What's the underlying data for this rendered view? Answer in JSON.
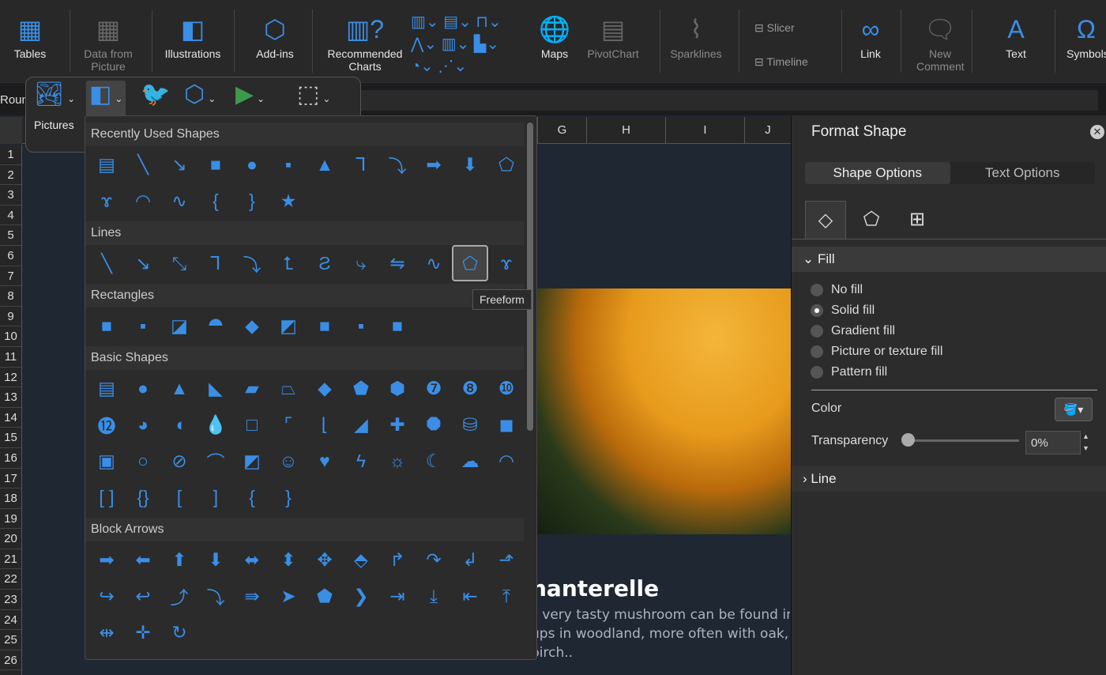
{
  "ribbon": {
    "items": [
      {
        "label": "Tables",
        "icon": "table-icon",
        "glyph": "▦",
        "enabled": true
      },
      {
        "label": "Data from Picture",
        "icon": "data-from-picture-icon",
        "glyph": "▦",
        "enabled": false
      },
      {
        "label": "Illustrations",
        "icon": "shapes-icon",
        "glyph": "◧",
        "enabled": true
      },
      {
        "label": "Add-ins",
        "icon": "hexagon-addins-icon",
        "glyph": "⬡",
        "enabled": true
      },
      {
        "label": "Recommended Charts",
        "icon": "recommended-charts-icon",
        "glyph": "▥?",
        "enabled": true
      },
      {
        "label": "Maps",
        "icon": "globe-icon",
        "glyph": "🌐",
        "enabled": true
      },
      {
        "label": "PivotChart",
        "icon": "pivotchart-icon",
        "glyph": "▤",
        "enabled": false
      },
      {
        "label": "Sparklines",
        "icon": "sparklines-icon",
        "glyph": "⌇",
        "enabled": false
      },
      {
        "label": "Link",
        "icon": "link-icon",
        "glyph": "∞",
        "enabled": true
      },
      {
        "label": "New Comment",
        "icon": "new-comment-icon",
        "glyph": "🗨",
        "enabled": false
      },
      {
        "label": "Text",
        "icon": "text-icon",
        "glyph": "A",
        "enabled": true
      },
      {
        "label": "Symbols",
        "icon": "omega-icon",
        "glyph": "Ω",
        "enabled": true
      }
    ],
    "slicer": "Slicer",
    "timeline": "Timeline"
  },
  "name_box": "Roun",
  "illustrations_popover": {
    "pictures_label": "Pictures",
    "items": [
      "pictures-icon",
      "shapes-icon",
      "icons-icon",
      "3d-models-icon",
      "smartart-icon",
      "screenshot-icon"
    ]
  },
  "columns": [
    "G",
    "H",
    "I",
    "J"
  ],
  "rows": [
    "1",
    "2",
    "3",
    "4",
    "5",
    "6",
    "7",
    "8",
    "9",
    "10",
    "11",
    "12",
    "13",
    "14",
    "15",
    "16",
    "17",
    "18",
    "19",
    "20",
    "21",
    "22",
    "23",
    "24",
    "25",
    "26"
  ],
  "slide": {
    "title": "hanterelle",
    "body": [
      "s very tasty mushroom can be found in sma",
      "ups in woodland, more often with oak, bee",
      "birch.."
    ]
  },
  "shapes_gallery": {
    "sections": [
      {
        "title": "Recently Used Shapes",
        "shapes": [
          "text-box",
          "line",
          "arrow-line",
          "rectangle",
          "oval",
          "rounded-rectangle",
          "triangle",
          "elbow-connector",
          "elbow-arrow-connector",
          "right-arrow",
          "down-arrow",
          "freeform",
          "scribble",
          "arc",
          "curve",
          "left-brace",
          "right-brace",
          "star"
        ]
      },
      {
        "title": "Lines",
        "shapes": [
          "line",
          "arrow-line",
          "double-arrow-line",
          "elbow-connector",
          "elbow-arrow-connector",
          "elbow-double-arrow",
          "curved-connector",
          "curved-arrow-connector",
          "curved-double-arrow",
          "curve",
          "freeform",
          "scribble"
        ]
      },
      {
        "title": "Rectangles",
        "shapes": [
          "rectangle",
          "rounded-rectangle",
          "snip-single-corner",
          "snip-same-side",
          "snip-diagonal",
          "snip-round",
          "round-single-corner",
          "round-same-side",
          "round-diagonal"
        ]
      },
      {
        "title": "Basic Shapes",
        "shapes": [
          "text-box",
          "oval",
          "triangle",
          "right-triangle",
          "parallelogram",
          "trapezoid",
          "diamond",
          "pentagon",
          "hexagon",
          "heptagon",
          "octagon",
          "decagon",
          "dodecagon",
          "pie",
          "chord",
          "teardrop",
          "frame",
          "half-frame",
          "l-shape",
          "diagonal-stripe",
          "cross",
          "plaque",
          "can",
          "cube",
          "bevel",
          "donut",
          "no-symbol",
          "block-arc",
          "folded-corner",
          "smiley-face",
          "heart",
          "lightning-bolt",
          "sun",
          "moon",
          "cloud",
          "arc",
          "double-bracket",
          "double-brace",
          "left-bracket",
          "right-bracket",
          "left-brace",
          "right-brace"
        ]
      },
      {
        "title": "Block Arrows",
        "shapes": [
          "right-arrow",
          "left-arrow",
          "up-arrow",
          "down-arrow",
          "left-right-arrow",
          "up-down-arrow",
          "quad-arrow",
          "left-right-up-arrow",
          "bent-arrow",
          "u-turn-arrow",
          "left-up-arrow",
          "bent-up-arrow",
          "curved-right-arrow",
          "curved-left-arrow",
          "curved-up-arrow",
          "curved-down-arrow",
          "striped-right-arrow",
          "notched-right-arrow",
          "pentagon-arrow",
          "chevron",
          "right-arrow-callout",
          "down-arrow-callout",
          "left-arrow-callout",
          "up-arrow-callout",
          "left-right-arrow-callout",
          "quad-arrow-callout",
          "circular-arrow"
        ]
      }
    ],
    "selected": "freeform",
    "tooltip": "Freeform"
  },
  "format_shape": {
    "title": "Format Shape",
    "tabs": [
      "Shape Options",
      "Text Options"
    ],
    "active_tab": "Shape Options",
    "icon_tabs": [
      "fill-line-icon",
      "effects-pentagon-icon",
      "size-properties-icon"
    ],
    "fill_section": "Fill",
    "fill_options": [
      "No fill",
      "Solid fill",
      "Gradient fill",
      "Picture or texture fill",
      "Pattern fill"
    ],
    "selected_fill": "Solid fill",
    "color_label": "Color",
    "transparency_label": "Transparency",
    "transparency_value": "0%",
    "transparency_percent": 0,
    "line_section": "Line"
  },
  "colors": {
    "accent": "#3a8ee6"
  }
}
